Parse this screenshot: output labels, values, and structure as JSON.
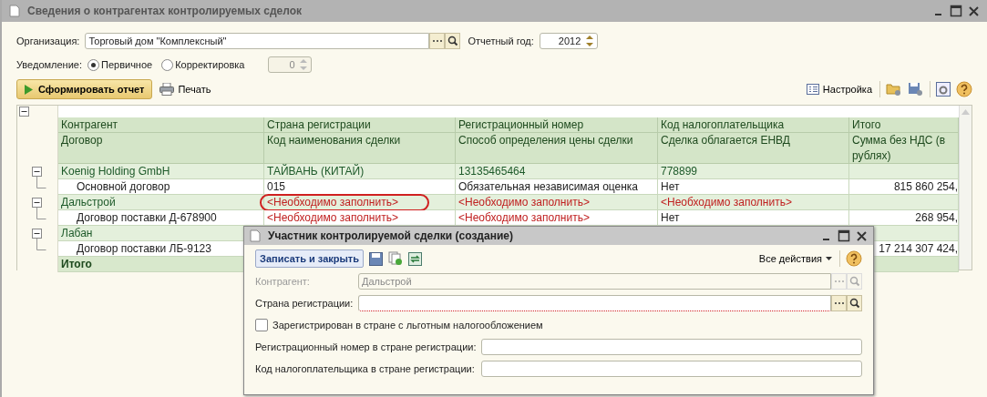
{
  "window": {
    "title": "Сведения о контрагентах контролируемых сделок"
  },
  "form": {
    "organization_label": "Организация:",
    "organization": "Торговый дом \"Комплексный\"",
    "year_label": "Отчетный год:",
    "year": "2012",
    "notice_label": "Уведомление:",
    "notice_options": [
      {
        "label": "Первичное",
        "selected": true
      },
      {
        "label": "Корректировка",
        "selected": false
      }
    ],
    "correction_number": "0",
    "correction_disabled": true
  },
  "toolbar": {
    "generate": "Сформировать отчет",
    "print": "Печать",
    "settings": "Настройка"
  },
  "table": {
    "expanded": true,
    "header_1": [
      "Контрагент",
      "Страна регистрации",
      "Регистрационный номер",
      "Код налогоплательщика",
      "Итого"
    ],
    "header_2": [
      "Договор",
      "Код наименования сделки",
      "Способ определения цены сделки",
      "Сделка облагается ЕНВД",
      "Сумма без НДС (в рублях)"
    ],
    "rows": [
      {
        "kind": "group",
        "expanded": true,
        "cells": [
          {
            "kind": "value",
            "text": "Koenig Holding GmbH"
          },
          {
            "kind": "value",
            "text": "ТАЙВАНЬ (КИТАЙ)"
          },
          {
            "kind": "value",
            "text": "13135465464"
          },
          {
            "kind": "value",
            "text": "778899"
          },
          {
            "kind": "empty"
          }
        ]
      },
      {
        "kind": "item",
        "cells": [
          {
            "kind": "value",
            "text": "Основной договор"
          },
          {
            "kind": "value",
            "text": "015"
          },
          {
            "kind": "value",
            "text": "Обязательная независимая оценка"
          },
          {
            "kind": "value",
            "text": "Нет"
          },
          {
            "kind": "number",
            "text": "815 860 254,"
          }
        ]
      },
      {
        "kind": "group",
        "expanded": true,
        "cells": [
          {
            "kind": "value",
            "text": "Дальстрой"
          },
          {
            "kind": "required",
            "text": "<Необходимо заполнить>",
            "circled": true
          },
          {
            "kind": "required",
            "text": "<Необходимо заполнить>"
          },
          {
            "kind": "required",
            "text": "<Необходимо заполнить>"
          },
          {
            "kind": "empty"
          }
        ]
      },
      {
        "kind": "item",
        "cells": [
          {
            "kind": "value",
            "text": "Договор поставки Д-678900"
          },
          {
            "kind": "required",
            "text": "<Необходимо заполнить>"
          },
          {
            "kind": "required",
            "text": "<Необходимо заполнить>"
          },
          {
            "kind": "value",
            "text": "Нет"
          },
          {
            "kind": "number",
            "text": "268 954,"
          }
        ]
      },
      {
        "kind": "group",
        "expanded": true,
        "cells": [
          {
            "kind": "value",
            "text": "Лабан"
          },
          {
            "kind": "empty"
          },
          {
            "kind": "empty"
          },
          {
            "kind": "empty"
          },
          {
            "kind": "empty"
          }
        ]
      },
      {
        "kind": "item",
        "cells": [
          {
            "kind": "value",
            "text": "Договор поставки ЛБ-9123"
          },
          {
            "kind": "empty"
          },
          {
            "kind": "empty"
          },
          {
            "kind": "empty"
          },
          {
            "kind": "number",
            "text": "17 214 307 424,"
          }
        ]
      },
      {
        "kind": "total",
        "cells": [
          {
            "kind": "value",
            "text": "Итого"
          },
          {
            "kind": "empty"
          },
          {
            "kind": "empty"
          },
          {
            "kind": "empty"
          },
          {
            "kind": "empty"
          }
        ]
      }
    ]
  },
  "dialog": {
    "title": "Участник контролируемой сделки (создание)",
    "save_close": "Записать и закрыть",
    "all_actions": "Все действия",
    "fields": [
      {
        "kind": "select",
        "label": "Контрагент:",
        "value": "Дальстрой",
        "disabled": true,
        "required": false
      },
      {
        "kind": "select",
        "label": "Страна регистрации:",
        "disabled": false,
        "required": true
      },
      {
        "kind": "checkbox",
        "label": "Зарегистрирован в стране с льготным налогообложением",
        "checked": false
      },
      {
        "kind": "text",
        "label": "Регистрационный номер в стране регистрации:",
        "disabled": false,
        "required": false
      },
      {
        "kind": "text",
        "label": "Код налогоплательщика в стране регистрации:",
        "disabled": false,
        "required": false
      }
    ]
  }
}
